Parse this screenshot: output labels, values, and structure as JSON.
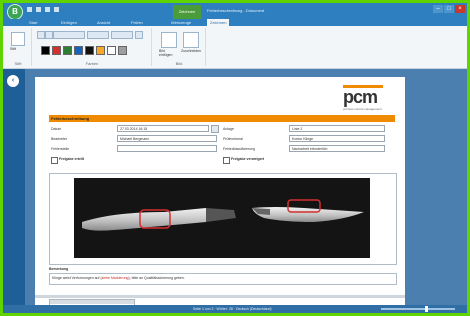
{
  "app": {
    "title": "Fehlerbeschreibung - Dokument",
    "contextual_tab": "Zeichnen",
    "orb_letter": "B"
  },
  "ribbon_tabs": [
    "Start",
    "Einfügen",
    "Ansicht",
    "Prüfen",
    "Werkzeuge",
    "Zeichnen"
  ],
  "ribbon": {
    "groups": [
      "Stift",
      "Farben",
      "Bild"
    ],
    "buttons": {
      "pen": "Stift",
      "eraser": "Radierer",
      "insert_image": "Bild einfügen",
      "crop": "Zuschneiden"
    },
    "colors": [
      "#000000",
      "#d32f2f",
      "#2e7d32",
      "#1565c0",
      "#111111",
      "#f9a825",
      "#ffffff",
      "#9e9e9e"
    ]
  },
  "document": {
    "logo": "pcm",
    "logo_subtitle": "prozess control management",
    "section_title": "Fehlerbeschreibung",
    "fields": {
      "left": [
        {
          "label": "Datum",
          "value": "27.03.2014 16:15"
        },
        {
          "label": "Bearbeiter",
          "value": "Michael Bergmann"
        },
        {
          "label": "Fehlerstelle",
          "value": ""
        }
      ],
      "right": [
        {
          "label": "Anlage",
          "value": "Linie 2"
        },
        {
          "label": "Prüfmerkmal",
          "value": "Kontur Klinge"
        },
        {
          "label": "Fehlerklassifizierung",
          "value": "Nacharbeit erforderlich"
        }
      ]
    },
    "checkboxes": {
      "left": "Freigabe erteilt",
      "right": "Freigabe verweigert"
    },
    "notes_label": "Bemerkung",
    "notes_text_before": "Klinge weist Verformungen auf (",
    "notes_text_highlight": "siehe Markierung",
    "notes_text_after": "), bitte an Qualitätssicherung geben."
  },
  "status": {
    "text": "Seite 1 von 2 · Wörter: 28 · Deutsch (Deutschland)",
    "zoom": 0.6
  }
}
